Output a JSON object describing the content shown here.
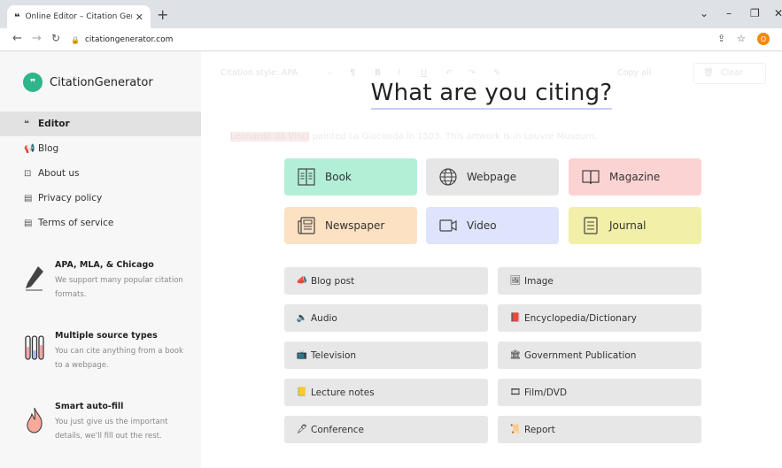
{
  "browser": {
    "tab_title": "Online Editor – Citation Generat",
    "tab_favicon": "❝",
    "new_tab": "+",
    "url": "citationgenerator.com",
    "profile_initial": "O"
  },
  "sidebar": {
    "brand": "CitationGenerator",
    "brand_logo": "❞",
    "nav": [
      {
        "label": "Editor",
        "icon": "66"
      },
      {
        "label": "Blog",
        "icon": "megaphone-icon"
      },
      {
        "label": "About us",
        "icon": "info-icon"
      },
      {
        "label": "Privacy policy",
        "icon": "document-icon"
      },
      {
        "label": "Terms of service",
        "icon": "document-icon"
      }
    ],
    "features": [
      {
        "title": "APA, MLA, & Chicago",
        "desc": "We support many popular citation formats.",
        "icon": "pen-icon"
      },
      {
        "title": "Multiple source types",
        "desc": "You can cite anything from a book to a webpage.",
        "icon": "test-tubes-icon"
      },
      {
        "title": "Smart auto-fill",
        "desc": "You just give us the important details, we'll fill out the rest.",
        "icon": "flame-icon"
      }
    ]
  },
  "main": {
    "headline": "What are you citing?",
    "ghost_toolbar": {
      "style": "Citation style: APA",
      "copy_all": "Copy all",
      "clear": "Clear"
    },
    "ghost_sentence": {
      "highlight": "Leonardo da Vinci",
      "rest": " painted La Gioconda in 1503. This artwork is in Louvre Museum."
    },
    "categories": [
      {
        "label": "Book",
        "icon": "book-icon",
        "color": "#b3efd7"
      },
      {
        "label": "Webpage",
        "icon": "globe-icon",
        "color": "#e6e6e6"
      },
      {
        "label": "Magazine",
        "icon": "open-book-icon",
        "color": "#fbd3d3"
      },
      {
        "label": "Newspaper",
        "icon": "newspaper-icon",
        "color": "#fce1c2"
      },
      {
        "label": "Video",
        "icon": "video-camera-icon",
        "color": "#dde4fb"
      },
      {
        "label": "Journal",
        "icon": "journal-icon",
        "color": "#f1efa8"
      }
    ],
    "sources": [
      {
        "label": "Blog post",
        "emoji": "📣"
      },
      {
        "label": "Image",
        "emoji": "🖼"
      },
      {
        "label": "Audio",
        "emoji": "🔈"
      },
      {
        "label": "Encyclopedia/Dictionary",
        "emoji": "📕"
      },
      {
        "label": "Television",
        "emoji": "📺"
      },
      {
        "label": "Government Publication",
        "emoji": "🏛"
      },
      {
        "label": "Lecture notes",
        "emoji": "📒"
      },
      {
        "label": "Film/DVD",
        "emoji": "🎞"
      },
      {
        "label": "Conference",
        "emoji": "🖋"
      },
      {
        "label": "Report",
        "emoji": "📜"
      }
    ]
  }
}
